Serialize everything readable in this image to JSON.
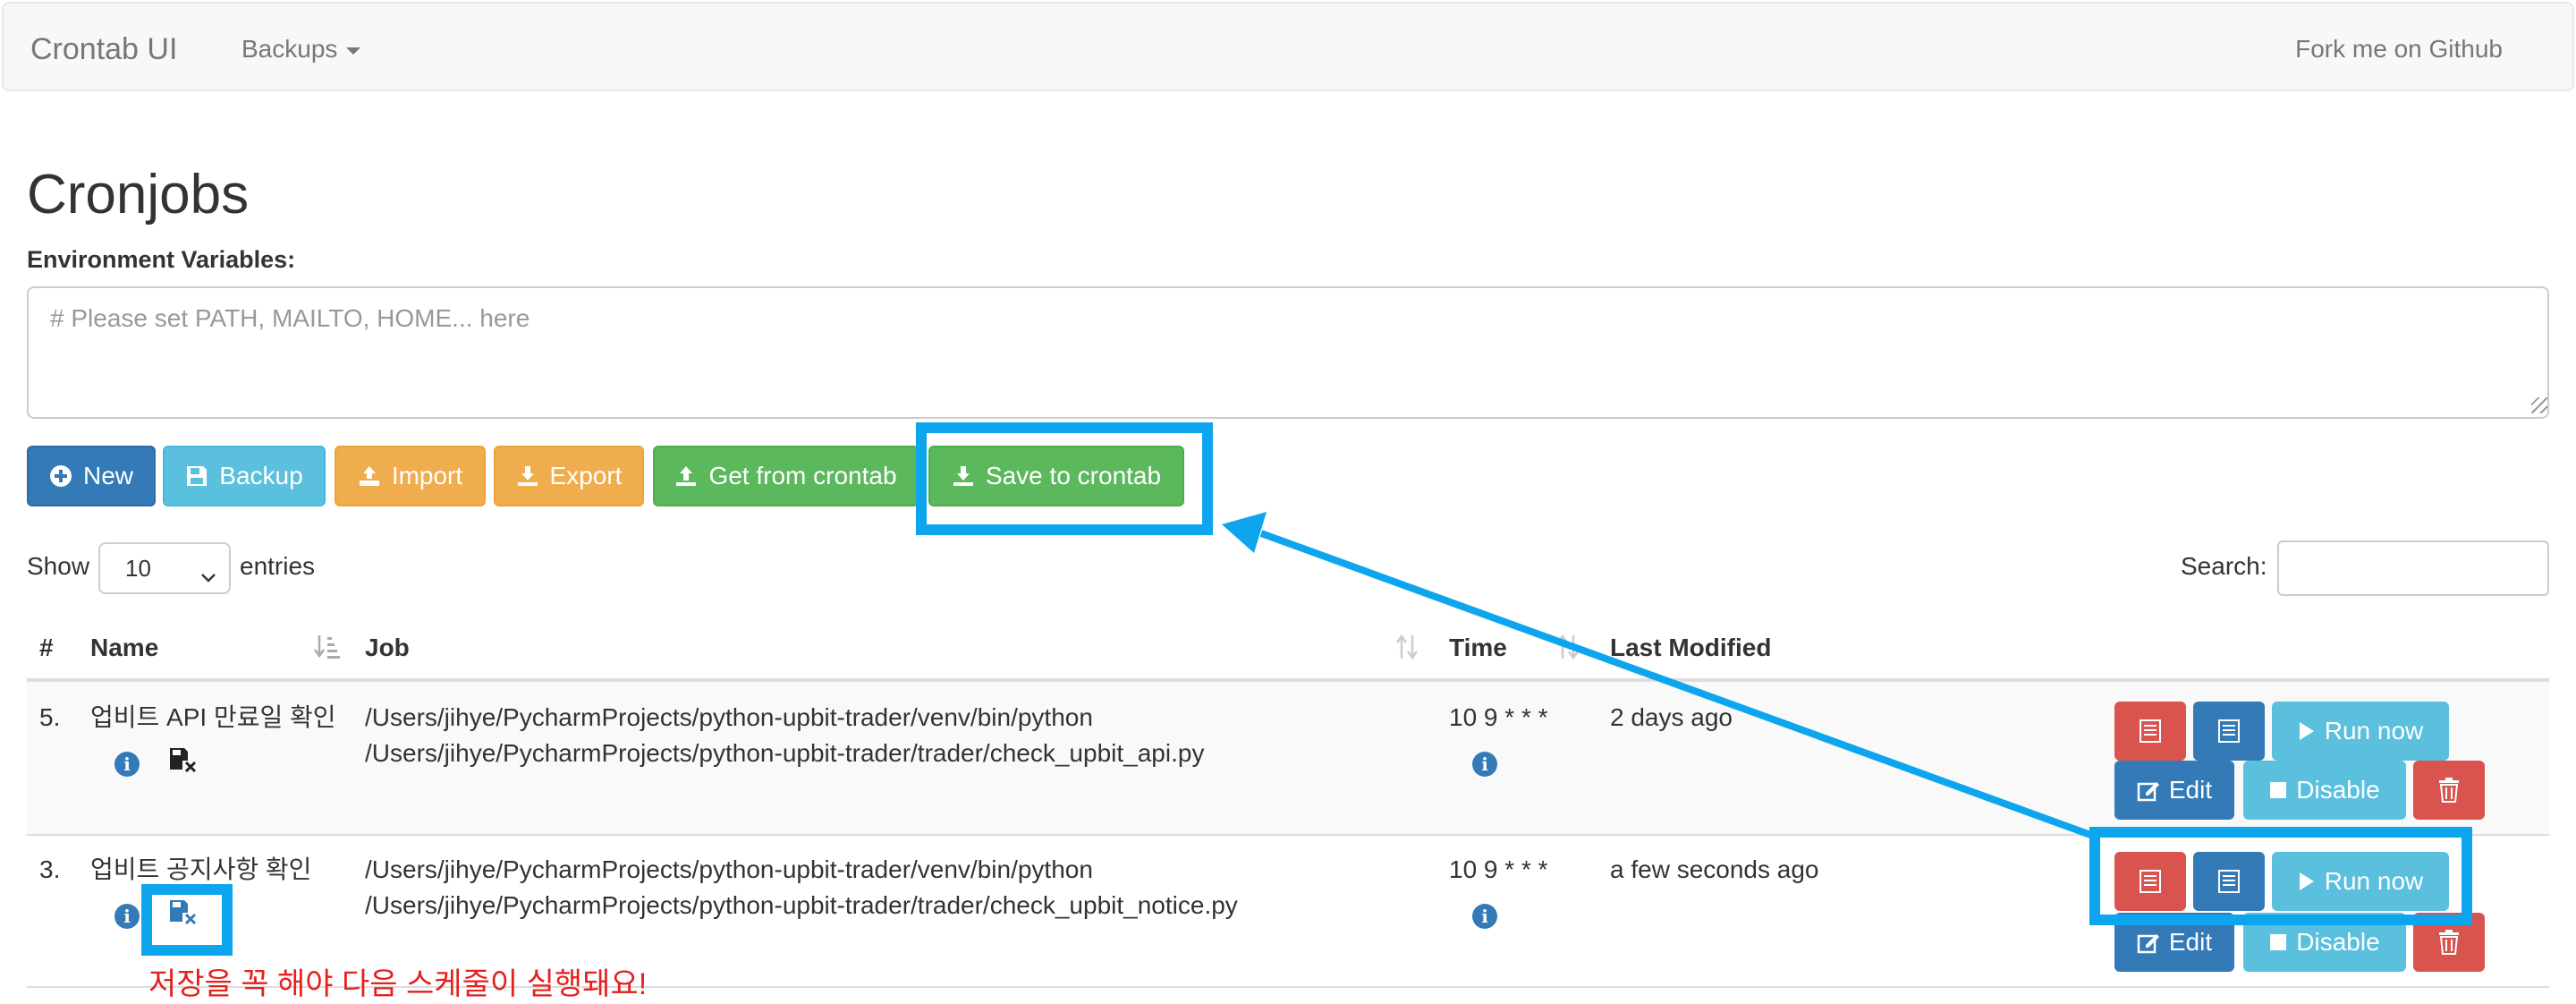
{
  "navbar": {
    "brand": "Crontab UI",
    "backups_label": "Backups",
    "fork_label": "Fork me on Github"
  },
  "page": {
    "title": "Cronjobs",
    "env_label": "Environment Variables:",
    "env_placeholder": "# Please set PATH, MAILTO, HOME... here"
  },
  "actions": {
    "new": "New",
    "backup": "Backup",
    "import": "Import",
    "export": "Export",
    "get_from_crontab": "Get from crontab",
    "save_to_crontab": "Save to crontab"
  },
  "table_controls": {
    "show_label": "Show",
    "entries_value": "10",
    "entries_label": "entries",
    "search_label": "Search:"
  },
  "table": {
    "headers": [
      "#",
      "Name",
      "Job",
      "Time",
      "Last Modified"
    ],
    "rows": [
      {
        "num": "5.",
        "name": "업비트 API 만료일 확인",
        "job_line1": "/Users/jihye/PycharmProjects/python-upbit-trader/venv/bin/python",
        "job_line2": "/Users/jihye/PycharmProjects/python-upbit-trader/trader/check_upbit_api.py",
        "time": "10 9 * * *",
        "modified": "2 days ago",
        "run_label": "Run now",
        "edit_label": "Edit",
        "disable_label": "Disable"
      },
      {
        "num": "3.",
        "name": "업비트 공지사항 확인",
        "job_line1": "/Users/jihye/PycharmProjects/python-upbit-trader/venv/bin/python",
        "job_line2": "/Users/jihye/PycharmProjects/python-upbit-trader/trader/check_upbit_notice.py",
        "time": "10 9 * * *",
        "modified": "a few seconds ago",
        "run_label": "Run now",
        "edit_label": "Edit",
        "disable_label": "Disable"
      }
    ]
  },
  "annotation": {
    "note": "저장을 꼭 해야 다음 스케줄이 실행돼요!",
    "highlight_color": "#0ea5ef",
    "text_color": "#e5201f"
  },
  "icons": [
    "plus-circle-icon",
    "floppy-icon",
    "import-icon",
    "download-icon",
    "upload-icon",
    "sort-icon",
    "info-icon",
    "unsaved-icon",
    "log-icon",
    "list-icon",
    "play-icon",
    "edit-icon",
    "stop-icon",
    "trash-icon"
  ]
}
